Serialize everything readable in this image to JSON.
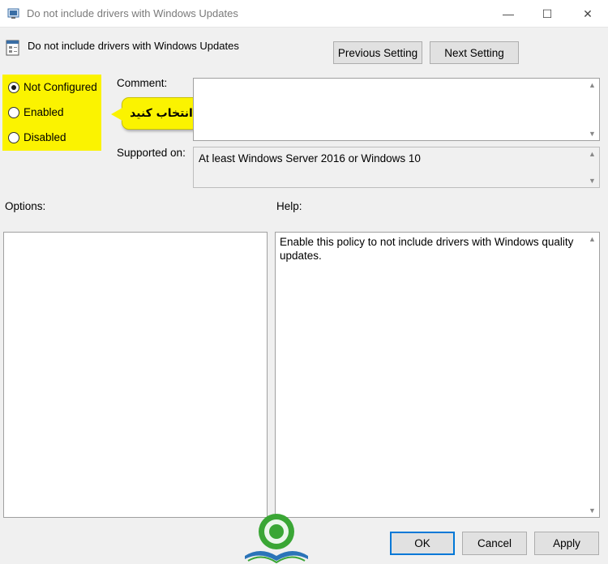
{
  "window": {
    "title": "Do not include drivers with Windows Updates",
    "controls": {
      "minimize": "—",
      "maximize": "☐",
      "close": "✕"
    }
  },
  "header": {
    "policy_title": "Do not include drivers with Windows Updates",
    "previous_label": "Previous Setting",
    "next_label": "Next Setting"
  },
  "state": {
    "options": [
      {
        "label": "Not Configured",
        "checked": true
      },
      {
        "label": "Enabled",
        "checked": false
      },
      {
        "label": "Disabled",
        "checked": false
      }
    ],
    "callout": "انتخاب کنید",
    "highlight_color": "#fbf300"
  },
  "comment": {
    "label": "Comment:",
    "value": ""
  },
  "supported": {
    "label": "Supported on:",
    "value": "At least Windows Server 2016 or Windows 10"
  },
  "options": {
    "label": "Options:"
  },
  "help": {
    "label": "Help:",
    "text": "Enable this policy to not include drivers with Windows quality updates."
  },
  "footer": {
    "ok": "OK",
    "cancel": "Cancel",
    "apply": "Apply"
  },
  "icons": {
    "app": "policy-editor-icon",
    "policy": "policy-setting-icon",
    "scroll_up": "▲",
    "scroll_down": "▼",
    "watermark": "learning-logo-icon"
  },
  "colors": {
    "accent": "#0078d7"
  }
}
